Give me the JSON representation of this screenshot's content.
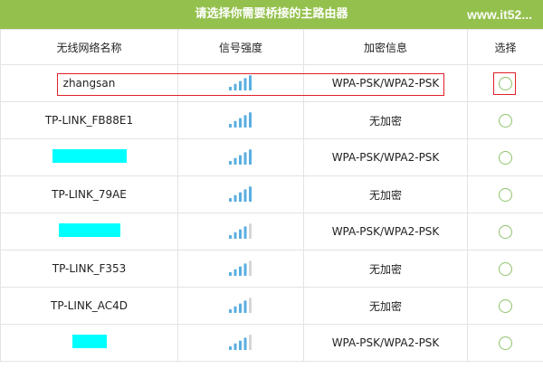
{
  "header": {
    "title": "请选择你需要桥接的主路由器"
  },
  "watermark": {
    "text": "www.it52..."
  },
  "table": {
    "columns": [
      "无线网络名称",
      "信号强度",
      "加密信息",
      "选择"
    ],
    "rows": [
      {
        "ssid": "zhangsan",
        "signal_bars": 5,
        "encryption": "WPA-PSK/WPA2-PSK",
        "selected": false,
        "highlighted": true
      },
      {
        "ssid": "TP-LINK_FB88E1",
        "signal_bars": 5,
        "encryption": "无加密",
        "selected": false
      },
      {
        "ssid": "",
        "redacted": true,
        "signal_bars": 5,
        "encryption": "WPA-PSK/WPA2-PSK",
        "selected": false
      },
      {
        "ssid": "TP-LINK_79AE",
        "signal_bars": 5,
        "encryption": "无加密",
        "selected": false
      },
      {
        "ssid": "",
        "redacted": true,
        "signal_bars": 4,
        "encryption": "WPA-PSK/WPA2-PSK",
        "selected": false
      },
      {
        "ssid": "TP-LINK_F353",
        "signal_bars": 4,
        "encryption": "无加密",
        "selected": false
      },
      {
        "ssid": "TP-LINK_AC4D",
        "signal_bars": 4,
        "encryption": "无加密",
        "selected": false
      },
      {
        "ssid": "",
        "redacted": true,
        "signal_bars": 4,
        "encryption": "WPA-PSK/WPA2-PSK",
        "selected": false
      }
    ]
  },
  "colors": {
    "header_bg": "#94c14d",
    "signal_on": "#5aaee0",
    "signal_off": "#d6d6d6",
    "radio_border": "#8dc36b",
    "highlight": "#e0202a",
    "redaction": "#00ffff"
  }
}
